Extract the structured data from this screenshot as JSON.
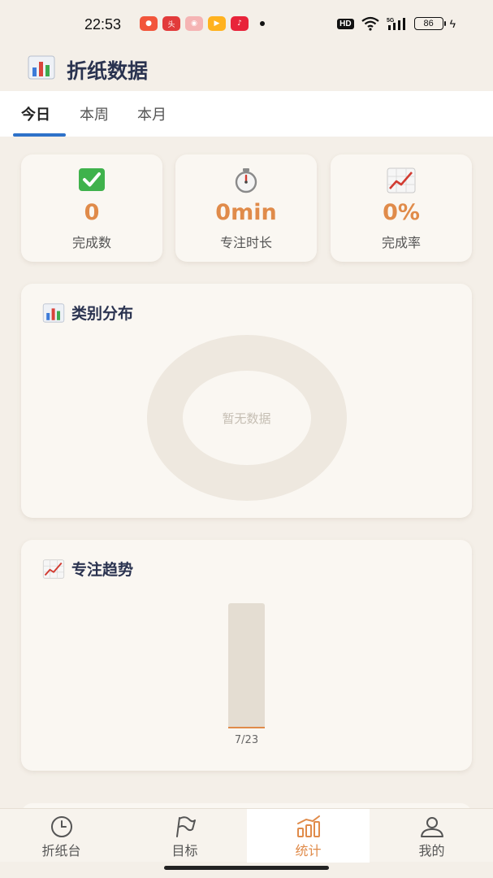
{
  "status_bar": {
    "time": "22:53",
    "battery": "86",
    "hd": "HD",
    "signal_label": "5G"
  },
  "header": {
    "title": "折纸数据",
    "icon": "bar-chart-icon"
  },
  "tabs": [
    {
      "label": "今日",
      "active": true
    },
    {
      "label": "本周",
      "active": false
    },
    {
      "label": "本月",
      "active": false
    }
  ],
  "stats": [
    {
      "icon": "check-mark-icon",
      "value": "0",
      "label": "完成数"
    },
    {
      "icon": "stopwatch-icon",
      "value": "0min",
      "label": "专注时长"
    },
    {
      "icon": "trend-up-icon",
      "value": "0%",
      "label": "完成率"
    }
  ],
  "category": {
    "title": "类别分布",
    "empty_text": "暂无数据"
  },
  "trend": {
    "title": "专注趋势"
  },
  "chart_data": {
    "type": "bar",
    "title": "专注趋势",
    "categories": [
      "7/23"
    ],
    "values": [
      0
    ],
    "xlabel": "",
    "ylabel": ""
  },
  "nav": [
    {
      "label": "折纸台",
      "icon": "clock-icon",
      "active": false
    },
    {
      "label": "目标",
      "icon": "flag-icon",
      "active": false
    },
    {
      "label": "统计",
      "icon": "stats-chart-icon",
      "active": true
    },
    {
      "label": "我的",
      "icon": "person-icon",
      "active": false
    }
  ],
  "colors": {
    "accent": "#e08b4a",
    "tab_indicator": "#2e72c9",
    "title": "#2a3350",
    "background": "#f4efe8"
  }
}
